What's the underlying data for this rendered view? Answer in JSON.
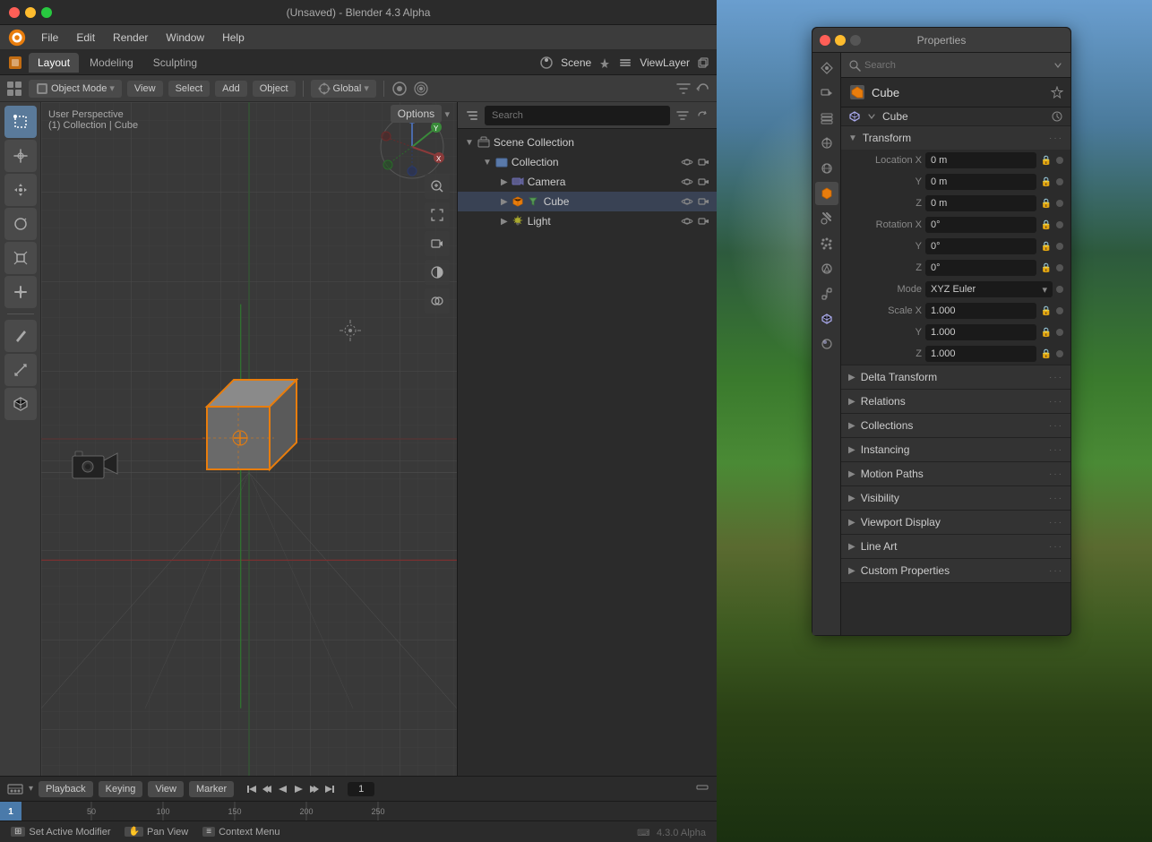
{
  "window": {
    "title": "(Unsaved) - Blender 4.3 Alpha",
    "version": "4.3.0 Alpha"
  },
  "titlebar": {
    "buttons": {
      "close": "●",
      "minimize": "●",
      "maximize": "●"
    }
  },
  "menubar": {
    "items": [
      "File",
      "Edit",
      "Render",
      "Window",
      "Help"
    ]
  },
  "workspaceTabs": {
    "items": [
      "Layout",
      "Modeling",
      "Sculpting"
    ],
    "active": "Layout",
    "scene": "Scene",
    "viewlayer": "ViewLayer"
  },
  "viewport": {
    "mode": "Object Mode",
    "view": "View",
    "select": "Select",
    "add": "Add",
    "object": "Object",
    "transform": "Global",
    "info": "User Perspective",
    "collection": "(1) Collection | Cube",
    "options_label": "Options"
  },
  "outliner": {
    "search_placeholder": "Search",
    "scene_collection": "Scene Collection",
    "collection": "Collection",
    "items": [
      {
        "name": "Camera",
        "icon": "📷",
        "indent": 2
      },
      {
        "name": "Cube",
        "icon": "🟧",
        "indent": 2
      },
      {
        "name": "Light",
        "icon": "💡",
        "indent": 2
      }
    ]
  },
  "properties": {
    "title": "Properties",
    "search_placeholder": "Search",
    "object_name": "Cube",
    "object_mesh_name": "Cube",
    "sections": [
      {
        "name": "Transform",
        "expanded": true,
        "fields": [
          {
            "label": "Location X",
            "value": "0 m"
          },
          {
            "label": "Y",
            "value": "0 m"
          },
          {
            "label": "Z",
            "value": "0 m"
          },
          {
            "label": "Rotation X",
            "value": "0°"
          },
          {
            "label": "Y",
            "value": "0°"
          },
          {
            "label": "Z",
            "value": "0°"
          },
          {
            "label": "Mode",
            "value": "XYZ Euler",
            "type": "dropdown"
          },
          {
            "label": "Scale X",
            "value": "1.000"
          },
          {
            "label": "Y",
            "value": "1.000"
          },
          {
            "label": "Z",
            "value": "1.000"
          }
        ]
      },
      {
        "name": "Delta Transform",
        "expanded": false
      },
      {
        "name": "Relations",
        "expanded": false
      },
      {
        "name": "Collections",
        "expanded": false
      },
      {
        "name": "Instancing",
        "expanded": false
      },
      {
        "name": "Motion Paths",
        "expanded": false
      },
      {
        "name": "Visibility",
        "expanded": false
      },
      {
        "name": "Viewport Display",
        "expanded": false
      },
      {
        "name": "Line Art",
        "expanded": false
      },
      {
        "name": "Custom Properties",
        "expanded": false
      }
    ]
  },
  "timeline": {
    "playback": "Playback",
    "keying": "Keying",
    "view": "View",
    "marker": "Marker",
    "frame": "1",
    "markers": [
      50,
      100,
      150,
      200,
      250
    ]
  },
  "statusbar": {
    "items": [
      {
        "icon": "⊞",
        "label": "Set Active Modifier"
      },
      {
        "icon": "✋",
        "label": "Pan View"
      },
      {
        "icon": "≡",
        "label": "Context Menu"
      }
    ],
    "version": "4.3.0 Alpha"
  },
  "icons": {
    "search": "🔍",
    "filter": "⊽",
    "pin": "📌",
    "eye": "👁",
    "camera": "📷",
    "cube": "⬜",
    "light": "💡",
    "lock": "🔒",
    "chevron_right": "▶",
    "chevron_down": "▼",
    "dots": "···"
  }
}
